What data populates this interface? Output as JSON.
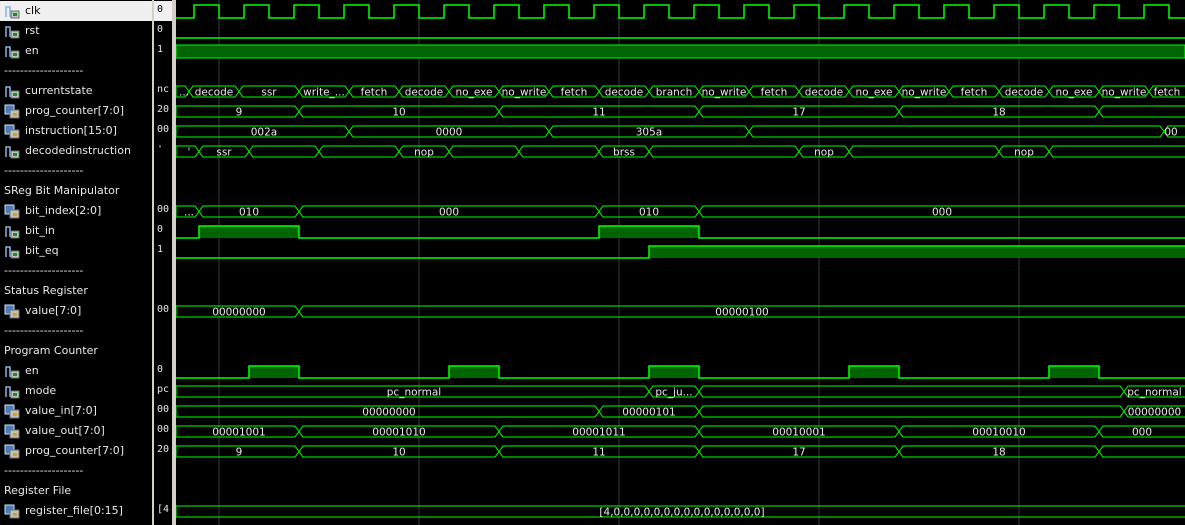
{
  "signals": [
    {
      "type": "signal",
      "icon": "bit",
      "name": "clk",
      "value": "0",
      "selected": true
    },
    {
      "type": "signal",
      "icon": "bit",
      "name": "rst",
      "value": "0"
    },
    {
      "type": "signal",
      "icon": "bit",
      "name": "en",
      "value": "1"
    },
    {
      "type": "divider",
      "name": "--------------------"
    },
    {
      "type": "signal",
      "icon": "bit",
      "name": "currentstate",
      "value": "nc"
    },
    {
      "type": "signal",
      "icon": "bus",
      "name": "prog_counter[7:0]",
      "value": "20"
    },
    {
      "type": "signal",
      "icon": "bus",
      "name": "instruction[15:0]",
      "value": "00"
    },
    {
      "type": "signal",
      "icon": "bit",
      "name": "decodedinstruction",
      "value": "'"
    },
    {
      "type": "divider",
      "name": "--------------------"
    },
    {
      "type": "group",
      "name": "SReg Bit Manipulator"
    },
    {
      "type": "signal",
      "icon": "bus",
      "name": "bit_index[2:0]",
      "value": "00"
    },
    {
      "type": "signal",
      "icon": "bit",
      "name": "bit_in",
      "value": "0"
    },
    {
      "type": "signal",
      "icon": "bit",
      "name": "bit_eq",
      "value": "1"
    },
    {
      "type": "divider",
      "name": "--------------------"
    },
    {
      "type": "group",
      "name": "Status Register"
    },
    {
      "type": "signal",
      "icon": "bus",
      "name": "value[7:0]",
      "value": "00"
    },
    {
      "type": "divider",
      "name": "--------------------"
    },
    {
      "type": "group",
      "name": "Program Counter"
    },
    {
      "type": "signal",
      "icon": "bit",
      "name": "en",
      "value": "0"
    },
    {
      "type": "signal",
      "icon": "bit",
      "name": "mode",
      "value": "pc"
    },
    {
      "type": "signal",
      "icon": "bus",
      "name": "value_in[7:0]",
      "value": "00"
    },
    {
      "type": "signal",
      "icon": "bus",
      "name": "value_out[7:0]",
      "value": "00"
    },
    {
      "type": "signal",
      "icon": "bus",
      "name": "prog_counter[7:0]",
      "value": "20"
    },
    {
      "type": "divider",
      "name": "--------------------"
    },
    {
      "type": "group",
      "name": "Register File"
    },
    {
      "type": "signal",
      "icon": "bus",
      "name": "register_file[0:15]",
      "value": "[4"
    }
  ],
  "waves": {
    "clk_period_cycles": 20,
    "currentstate": [
      {
        "t": 0,
        "label": "..."
      },
      {
        "t": 0.2,
        "label": "decode"
      },
      {
        "t": 1.2,
        "label": "ssr"
      },
      {
        "t": 2.4,
        "label": "write_..."
      },
      {
        "t": 3.4,
        "label": "fetch"
      },
      {
        "t": 4.4,
        "label": "decode"
      },
      {
        "t": 5.4,
        "label": "no_exe"
      },
      {
        "t": 6.4,
        "label": "no_write"
      },
      {
        "t": 7.4,
        "label": "fetch"
      },
      {
        "t": 8.4,
        "label": "decode"
      },
      {
        "t": 9.4,
        "label": "branch"
      },
      {
        "t": 10.4,
        "label": "no_write"
      },
      {
        "t": 11.4,
        "label": "fetch"
      },
      {
        "t": 12.4,
        "label": "decode"
      },
      {
        "t": 13.4,
        "label": "no_exe"
      },
      {
        "t": 14.4,
        "label": "no_write"
      },
      {
        "t": 15.4,
        "label": "fetch"
      },
      {
        "t": 16.4,
        "label": "decode"
      },
      {
        "t": 17.4,
        "label": "no_exe"
      },
      {
        "t": 18.4,
        "label": "no_write"
      },
      {
        "t": 19.4,
        "label": "fetch"
      }
    ],
    "prog_counter": [
      {
        "t": 0,
        "label": "9"
      },
      {
        "t": 2.4,
        "label": "10"
      },
      {
        "t": 6.4,
        "label": "11"
      },
      {
        "t": 10.4,
        "label": "17"
      },
      {
        "t": 14.4,
        "label": "18"
      },
      {
        "t": 18.4,
        "label": ""
      }
    ],
    "instruction": [
      {
        "t": 0,
        "label": "002a"
      },
      {
        "t": 3.4,
        "label": "0000"
      },
      {
        "t": 7.4,
        "label": "305a"
      },
      {
        "t": 11.4,
        "label": ""
      },
      {
        "t": 19.7,
        "label": "00"
      }
    ],
    "decodedinstruction": [
      {
        "t": 0,
        "label": "'"
      },
      {
        "t": 0.4,
        "label": "ssr"
      },
      {
        "t": 1.4,
        "label": ""
      },
      {
        "t": 2.8,
        "label": ""
      },
      {
        "t": 4.4,
        "label": "nop"
      },
      {
        "t": 5.4,
        "label": ""
      },
      {
        "t": 6.8,
        "label": ""
      },
      {
        "t": 8.4,
        "label": "brss"
      },
      {
        "t": 9.4,
        "label": ""
      },
      {
        "t": 12.4,
        "label": "nop"
      },
      {
        "t": 13.4,
        "label": ""
      },
      {
        "t": 16.4,
        "label": "nop"
      },
      {
        "t": 17.4,
        "label": ""
      }
    ],
    "bit_index": [
      {
        "t": 0,
        "label": "..."
      },
      {
        "t": 0.4,
        "label": "010"
      },
      {
        "t": 2.4,
        "label": "000"
      },
      {
        "t": 8.4,
        "label": "010"
      },
      {
        "t": 10.4,
        "label": "000"
      }
    ],
    "bit_in_high": [
      [
        0.4,
        2.4
      ],
      [
        8.4,
        10.4
      ]
    ],
    "bit_eq_high": [
      [
        9.4,
        20.2
      ]
    ],
    "sreg_value": [
      {
        "t": 0,
        "label": "00000000"
      },
      {
        "t": 2.4,
        "label": "00000100"
      }
    ],
    "pc_en_high": [
      [
        1.4,
        2.4
      ],
      [
        5.4,
        6.4
      ],
      [
        9.4,
        10.4
      ],
      [
        13.4,
        14.4
      ],
      [
        17.4,
        18.4
      ]
    ],
    "mode": [
      {
        "t": 0,
        "label": "pc_normal"
      },
      {
        "t": 9.4,
        "label": "pc_ju..."
      },
      {
        "t": 10.4,
        "label": ""
      },
      {
        "t": 18.9,
        "label": "pc_normal"
      }
    ],
    "value_in": [
      {
        "t": 0,
        "label": "00000000"
      },
      {
        "t": 8.4,
        "label": "00000101"
      },
      {
        "t": 10.4,
        "label": ""
      },
      {
        "t": 18.9,
        "label": "00000000"
      }
    ],
    "value_out": [
      {
        "t": 0,
        "label": "00001001"
      },
      {
        "t": 2.4,
        "label": "00001010"
      },
      {
        "t": 6.4,
        "label": "00001011"
      },
      {
        "t": 10.4,
        "label": "00010001"
      },
      {
        "t": 14.4,
        "label": "00010010"
      },
      {
        "t": 18.4,
        "label": "000"
      }
    ],
    "prog_counter_2": [
      {
        "t": 0,
        "label": "9"
      },
      {
        "t": 2.4,
        "label": "10"
      },
      {
        "t": 6.4,
        "label": "11"
      },
      {
        "t": 10.4,
        "label": "17"
      },
      {
        "t": 14.4,
        "label": "18"
      },
      {
        "t": 18.4,
        "label": ""
      }
    ],
    "register_file": [
      {
        "t": 0,
        "label": "[4,0,0,0,0,0,0,0,0,0,0,0,0,0,0,0]"
      }
    ]
  },
  "colors": {
    "wave": "#00ff00",
    "fill": "#006400",
    "text": "#e8e8e8",
    "grid": "#3a3a3a",
    "cursor": "#ffffff"
  }
}
